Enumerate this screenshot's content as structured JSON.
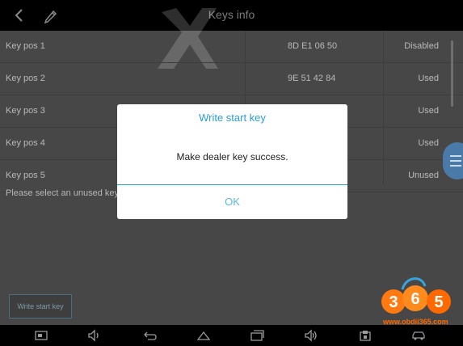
{
  "header": {
    "title": "Keys info"
  },
  "keys": [
    {
      "name": "Key pos 1",
      "id": "8D E1 06 50",
      "status": "Disabled"
    },
    {
      "name": "Key pos 2",
      "id": "9E 51 42 84",
      "status": "Used"
    },
    {
      "name": "Key pos 3",
      "id": "",
      "status": "Used"
    },
    {
      "name": "Key pos 4",
      "id": "",
      "status": "Used"
    },
    {
      "name": "Key pos 5",
      "id": "",
      "status": "Unused"
    }
  ],
  "hint": "Please select an unused key",
  "write_button_label": "Write start key",
  "dialog": {
    "title": "Write start key",
    "message": "Make dealer key success.",
    "ok_label": "OK"
  },
  "logo": {
    "digits": [
      "3",
      "6",
      "5"
    ],
    "url": "www.obdii365.com"
  },
  "colors": {
    "accent": "#2a9fd6",
    "logo_orange": "#ff6a00"
  },
  "navbar_icons": [
    "screenshot-icon",
    "volume-down-icon",
    "back-icon",
    "home-icon",
    "recents-icon",
    "volume-up-icon",
    "vci-icon",
    "car-icon"
  ]
}
